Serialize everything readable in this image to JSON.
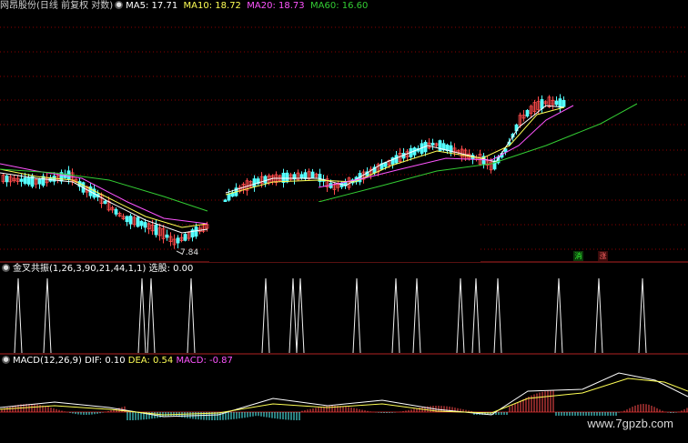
{
  "header": {
    "title": "网昂股份(日线 前复权 对数)",
    "ma5_label": "MA5: 17.71",
    "ma10_label": "MA10: 18.72",
    "ma20_label": "MA20: 18.73",
    "ma60_label": "MA60: 16.60"
  },
  "main_panel": {
    "low_marker": "7.84",
    "badge_green": "消",
    "badge_red": "涨"
  },
  "signal_panel": {
    "name": "金叉共振(1,26,3,90,21,44,1,1)",
    "value_label": "选股: 0.00",
    "spike_positions": [
      20,
      52,
      156,
      166,
      210,
      292,
      322,
      330,
      392,
      435,
      458,
      506,
      523,
      547,
      614,
      658,
      706
    ]
  },
  "macd_panel": {
    "name": "MACD(12,26,9)",
    "dif_label": "DIF: 0.10",
    "dea_label": "DEA: 0.54",
    "macd_label": "MACD: -0.87"
  },
  "watermark": "www.7gpzb.com",
  "colors": {
    "up": "#ff4b4b",
    "down": "#54ffff",
    "ma5": "#ffffff",
    "ma10": "#ffff55",
    "ma20": "#ff55ff",
    "ma60": "#33cc33",
    "separator": "#b22222",
    "grid": "#8b0000"
  }
}
